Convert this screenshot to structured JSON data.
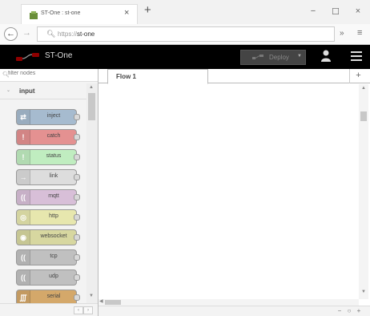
{
  "browser": {
    "tab_title": "ST-One : st-one",
    "tab_close": "×",
    "new_tab": "+",
    "minimize": "−",
    "maximize": "☐",
    "close": "×",
    "url_scheme": "https://",
    "url_host": "st-one",
    "back": "←",
    "forward": "→",
    "overflow": "»",
    "menu": "≡"
  },
  "header": {
    "title": "ST-One",
    "deploy_label": "Deploy",
    "deploy_caret": "▼"
  },
  "palette": {
    "filter_placeholder": "filter nodes",
    "category": "input",
    "category_chevron": "⌄",
    "nodes": [
      {
        "label": "inject",
        "color": "#a6bbcf",
        "icon": "⇄"
      },
      {
        "label": "catch",
        "color": "#e49191",
        "icon": "!"
      },
      {
        "label": "status",
        "color": "#c0edc0",
        "icon": "!"
      },
      {
        "label": "link",
        "color": "#dddddd",
        "icon": "→"
      },
      {
        "label": "mqtt",
        "color": "#d8bfd8",
        "icon": "(("
      },
      {
        "label": "http",
        "color": "#e7e7ae",
        "icon": "◎"
      },
      {
        "label": "websocket",
        "color": "#d7d7a0",
        "icon": "◉"
      },
      {
        "label": "tcp",
        "color": "#c0c0c0",
        "icon": "(("
      },
      {
        "label": "udp",
        "color": "#c0c0c0",
        "icon": "(("
      },
      {
        "label": "serial",
        "color": "#d4a86a",
        "icon": "∭"
      }
    ],
    "footer_left": "‹",
    "footer_right": "›"
  },
  "workspace": {
    "tab_label": "Flow 1",
    "add_tab": "+",
    "zoom_out": "−",
    "zoom_reset": "○",
    "zoom_in": "+"
  }
}
